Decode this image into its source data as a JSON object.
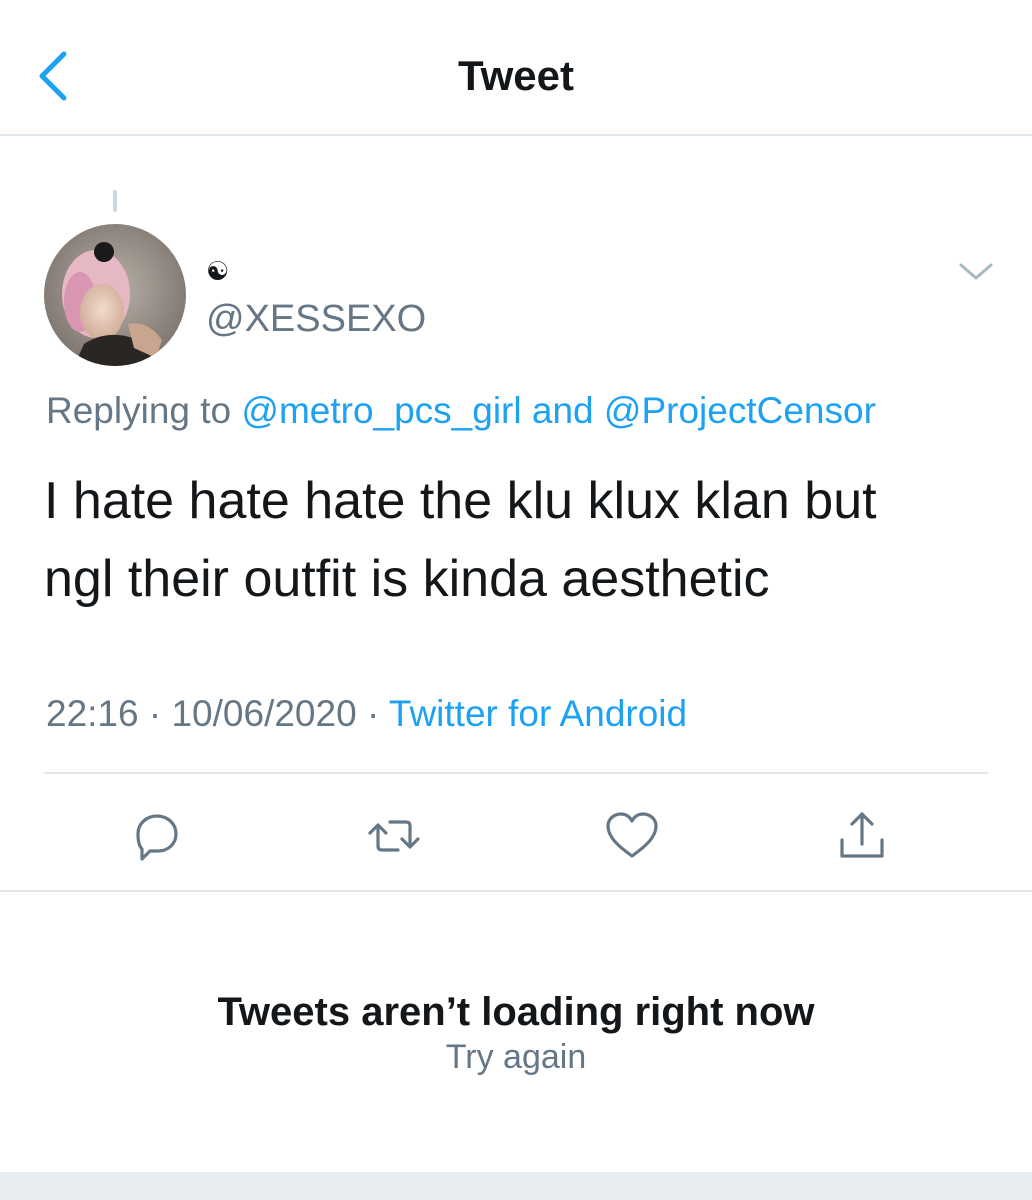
{
  "header": {
    "title": "Tweet",
    "back_icon": "chevron-left-icon",
    "accent_color": "#1da1f2"
  },
  "tweet": {
    "display_name": "☯",
    "handle": "@XESSEXO",
    "replying_prefix": "Replying to",
    "reply_to_1": "@metro_pcs_girl",
    "reply_and": "and",
    "reply_to_2": "@ProjectCensor",
    "text_line_1": "I hate hate hate the klu klux klan but",
    "text_line_2": "ngl their outfit is kinda aesthetic",
    "time": "22:16",
    "separator": "·",
    "date": "10/06/2020",
    "source": "Twitter for Android"
  },
  "actions": {
    "icons": [
      "reply-icon",
      "retweet-icon",
      "like-icon",
      "share-icon"
    ]
  },
  "error": {
    "title": "Tweets aren’t loading right now",
    "retry_label": "Try again"
  }
}
